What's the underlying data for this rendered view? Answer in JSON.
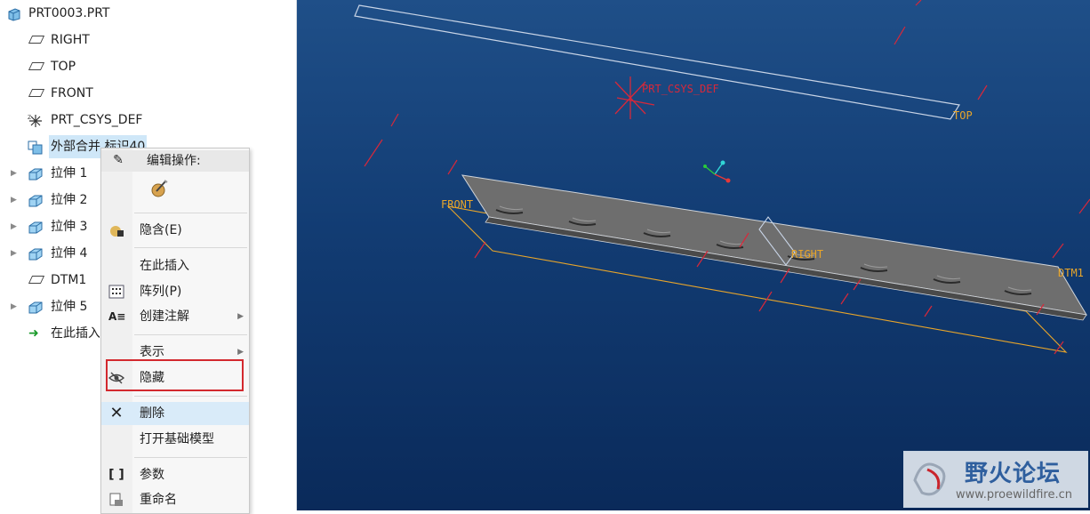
{
  "tree": {
    "items": [
      {
        "label": "PRT0003.PRT",
        "icon": "part-icon"
      },
      {
        "label": "RIGHT",
        "icon": "datum-plane-icon"
      },
      {
        "label": "TOP",
        "icon": "datum-plane-icon"
      },
      {
        "label": "FRONT",
        "icon": "datum-plane-icon"
      },
      {
        "label": "PRT_CSYS_DEF",
        "icon": "coordinate-system-icon"
      },
      {
        "label": "外部合并 标识40",
        "icon": "merge-feature-icon"
      },
      {
        "label": "拉伸 1",
        "icon": "extrude-icon"
      },
      {
        "label": "拉伸 2",
        "icon": "extrude-icon"
      },
      {
        "label": "拉伸 3",
        "icon": "extrude-icon"
      },
      {
        "label": "拉伸 4",
        "icon": "extrude-icon"
      },
      {
        "label": "DTM1",
        "icon": "datum-plane-icon"
      },
      {
        "label": "拉伸 5",
        "icon": "extrude-icon"
      },
      {
        "label": "在此插入",
        "icon": "insert-here-icon"
      }
    ]
  },
  "context_menu": {
    "header": "编辑操作:",
    "items": {
      "suppress": "隐含(E)",
      "insert_here": "在此插入",
      "pattern": "阵列(P)",
      "annotation": "创建注解",
      "display": "表示",
      "hide": "隐藏",
      "delete": "删除",
      "open_base": "打开基础模型",
      "params": "参数",
      "rename": "重命名"
    }
  },
  "viewport": {
    "labels": {
      "csys": "PRT_CSYS_DEF",
      "top": "TOP",
      "front": "FRONT",
      "right": "RIGHT",
      "dtm": "DTM1"
    },
    "colors": {
      "datum_plane": "#e8a52a",
      "datum_edge": "#d7283a",
      "part_face": "#6e6e6e"
    }
  },
  "watermark": {
    "title": "野火论坛",
    "url": "www.proewildfire.cn"
  }
}
